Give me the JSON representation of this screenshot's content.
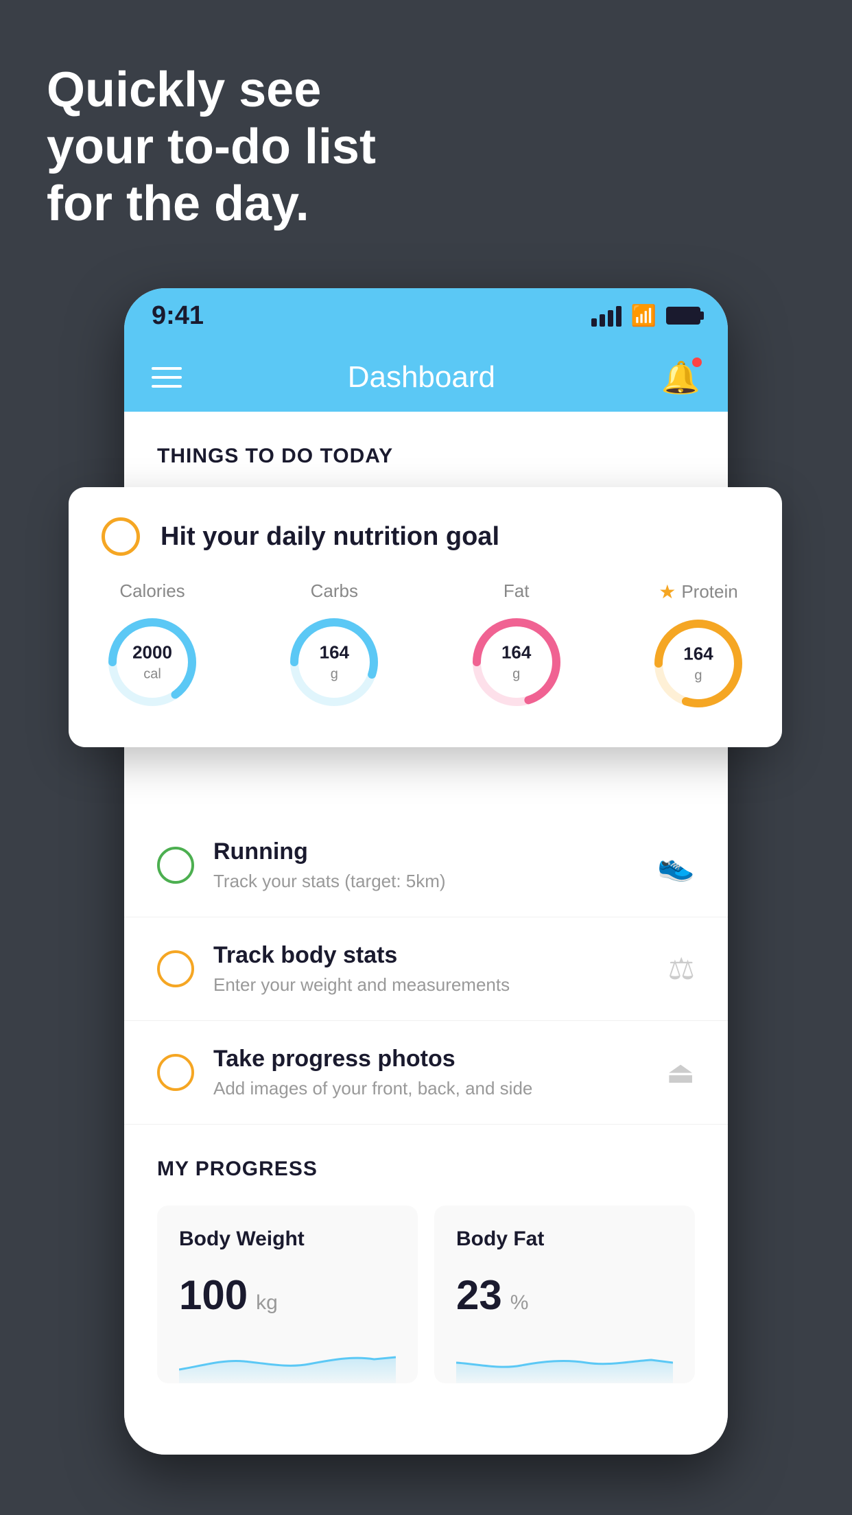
{
  "hero": {
    "line1": "Quickly see",
    "line2": "your to-do list",
    "line3": "for the day."
  },
  "phone": {
    "statusBar": {
      "time": "9:41"
    },
    "navBar": {
      "title": "Dashboard"
    },
    "thingsToDoTitle": "THINGS TO DO TODAY",
    "floatingCard": {
      "title": "Hit your daily nutrition goal",
      "nutrition": [
        {
          "label": "Calories",
          "value": "2000",
          "unit": "cal",
          "color": "#5bc8f5",
          "track": "#e0f5fc",
          "percent": 65
        },
        {
          "label": "Carbs",
          "value": "164",
          "unit": "g",
          "color": "#5bc8f5",
          "track": "#e0f5fc",
          "percent": 55
        },
        {
          "label": "Fat",
          "value": "164",
          "unit": "g",
          "color": "#f06292",
          "track": "#fde0ea",
          "percent": 70
        },
        {
          "label": "Protein",
          "value": "164",
          "unit": "g",
          "color": "#f5a623",
          "track": "#fef0d6",
          "percent": 80,
          "starred": true
        }
      ]
    },
    "todoItems": [
      {
        "label": "Running",
        "sub": "Track your stats (target: 5km)",
        "circleColor": "green",
        "iconType": "shoe"
      },
      {
        "label": "Track body stats",
        "sub": "Enter your weight and measurements",
        "circleColor": "yellow",
        "iconType": "scale"
      },
      {
        "label": "Take progress photos",
        "sub": "Add images of your front, back, and side",
        "circleColor": "yellow-outline",
        "iconType": "person"
      }
    ],
    "progressSection": {
      "title": "MY PROGRESS",
      "cards": [
        {
          "label": "Body Weight",
          "value": "100",
          "unit": "kg"
        },
        {
          "label": "Body Fat",
          "value": "23",
          "unit": "%"
        }
      ]
    }
  }
}
